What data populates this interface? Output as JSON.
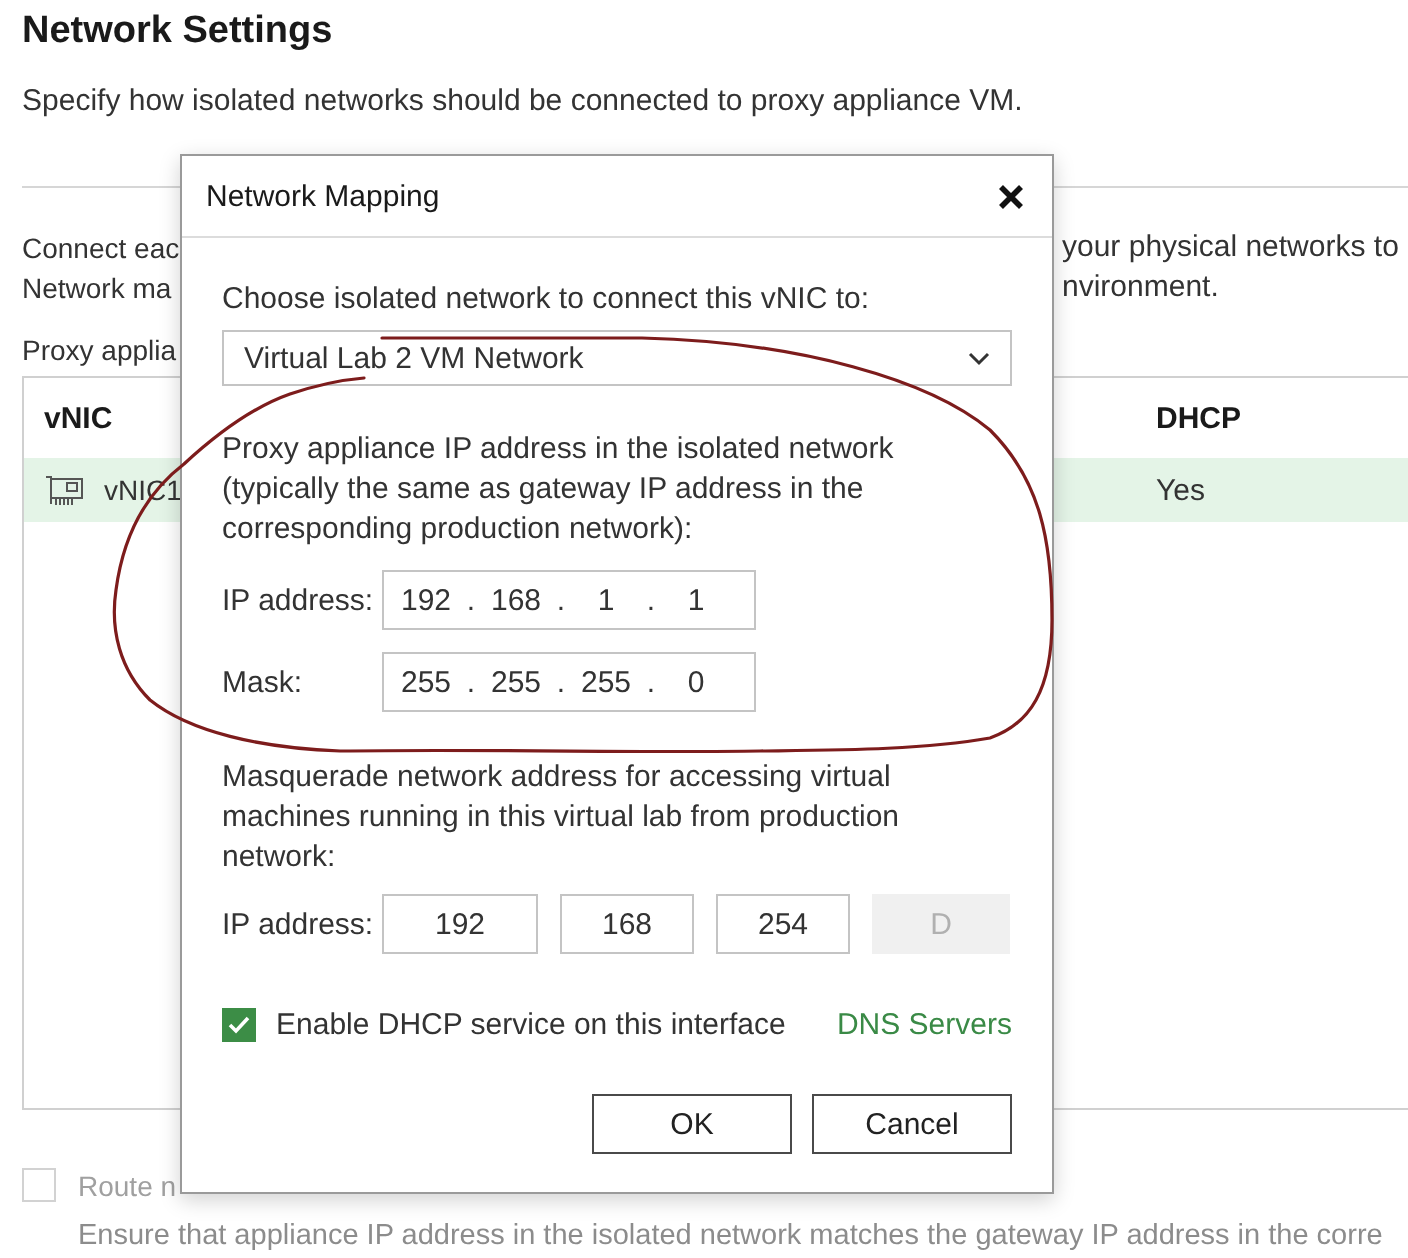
{
  "page": {
    "title": "Network Settings",
    "subtitle": "Specify how isolated networks should be connected to proxy appliance VM.",
    "intro_lines": [
      {
        "left": "Connect eac",
        "right": "your physical networks to"
      },
      {
        "left": "Network ma",
        "right": "nvironment."
      }
    ],
    "proxy_label": "Proxy applia",
    "table": {
      "columns": [
        "vNIC",
        "DHCP"
      ],
      "rows": [
        {
          "vnic": "vNIC1",
          "dhcp": "Yes",
          "selected": true
        }
      ]
    },
    "route_option": {
      "label": "Route n",
      "checked": false,
      "disabled": true
    },
    "note": "Ensure that appliance IP address in the isolated network matches the gateway IP address in the corre"
  },
  "dialog": {
    "title": "Network Mapping",
    "network_prompt": "Choose isolated network to connect this vNIC to:",
    "network_select": {
      "value": "Virtual Lab 2 VM Network"
    },
    "proxy_text": "Proxy appliance IP address in the isolated network (typically the same as gateway IP address in the corresponding production network):",
    "ip_fields": [
      {
        "label": "IP address:",
        "octets": [
          "192",
          "168",
          "1",
          "1"
        ],
        "separators": [
          ".",
          ".",
          "."
        ]
      },
      {
        "label": "Mask:",
        "octets": [
          "255",
          "255",
          "255",
          "0"
        ],
        "separators": [
          ".",
          ".",
          "."
        ]
      }
    ],
    "masquerade_text": "Masquerade network address for accessing virtual machines running in this virtual lab from production network:",
    "masquerade": {
      "label": "IP address:",
      "octets": [
        {
          "value": "192",
          "disabled": false
        },
        {
          "value": "168",
          "disabled": false
        },
        {
          "value": "254",
          "disabled": false
        },
        {
          "value": "D",
          "disabled": true
        }
      ]
    },
    "dhcp_option": {
      "label": "Enable DHCP service on this interface",
      "checked": true
    },
    "dns_link": "DNS Servers",
    "buttons": [
      "OK",
      "Cancel"
    ]
  },
  "annotations": [
    {
      "kind": "freehand-loop"
    }
  ]
}
